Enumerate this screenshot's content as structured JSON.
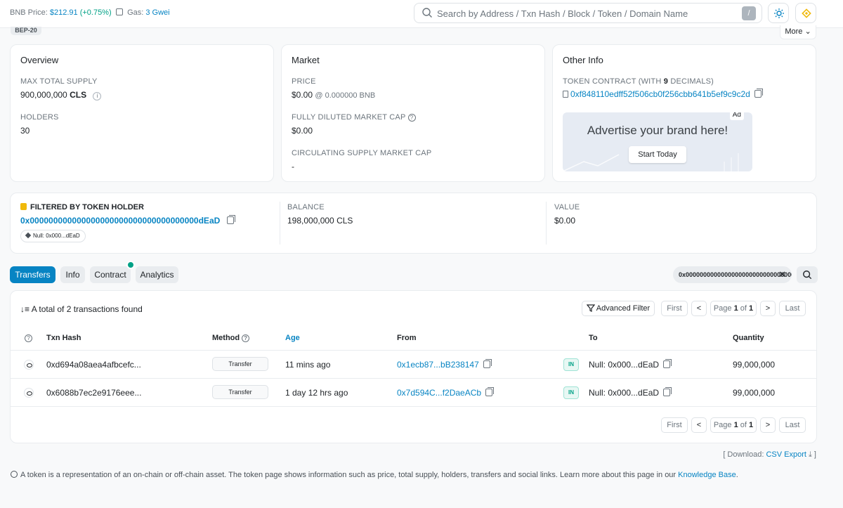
{
  "topbar": {
    "price_label": "BNB Price:",
    "price_value": "$212.91",
    "price_change": "(+0.75%)",
    "gas_label": "Gas:",
    "gas_value": "3 Gwei",
    "search_placeholder": "Search by Address / Txn Hash / Block / Token / Domain Name",
    "search_shortcut": "/"
  },
  "token_tag": "BEP-20",
  "more_label": "More",
  "overview": {
    "title": "Overview",
    "max_supply_label": "MAX TOTAL SUPPLY",
    "max_supply_value": "900,000,000",
    "max_supply_symbol": "CLS",
    "holders_label": "HOLDERS",
    "holders_value": "30"
  },
  "market": {
    "title": "Market",
    "price_label": "PRICE",
    "price_value": "$0.00",
    "price_bnb": "@ 0.000000 BNB",
    "fdmc_label": "FULLY DILUTED MARKET CAP",
    "fdmc_value": "$0.00",
    "csmc_label": "CIRCULATING SUPPLY MARKET CAP",
    "csmc_value": "-"
  },
  "other_info": {
    "title": "Other Info",
    "contract_label_pre": "TOKEN CONTRACT (WITH ",
    "contract_decimals": "9",
    "contract_label_post": " DECIMALS)",
    "contract_address": "0xf848110edff52f506cb0f256cbb641b5ef9c9c2d",
    "ad_label": "Ad",
    "ad_title": "Advertise your brand here!",
    "ad_button": "Start Today"
  },
  "holder": {
    "title": "FILTERED BY TOKEN HOLDER",
    "address": "0x000000000000000000000000000000000000dEaD",
    "tag": "Null: 0x000...dEaD",
    "balance_label": "BALANCE",
    "balance_value": "198,000,000 CLS",
    "value_label": "VALUE",
    "value_value": "$0.00"
  },
  "tabs": [
    "Transfers",
    "Info",
    "Contract",
    "Analytics"
  ],
  "filter_value": "0x0000000000000000000000000000000000...",
  "table": {
    "total_text": "A total of 2 transactions found",
    "advanced_filter": "Advanced Filter",
    "pager": {
      "first": "First",
      "prev": "<",
      "page_pre": "Page ",
      "page_cur": "1",
      "page_mid": " of ",
      "page_total": "1",
      "next": ">",
      "last": "Last"
    },
    "headers": {
      "txn": "Txn Hash",
      "method": "Method",
      "age": "Age",
      "from": "From",
      "to": "To",
      "qty": "Quantity"
    },
    "rows": [
      {
        "hash": "0xd694a08aea4afbcefc...",
        "method": "Transfer",
        "age": "11 mins ago",
        "from": "0x1ecb87...bB238147",
        "dir": "IN",
        "to": "Null: 0x000...dEaD",
        "qty": "99,000,000"
      },
      {
        "hash": "0x6088b7ec2e9176eee...",
        "method": "Transfer",
        "age": "1 day 12 hrs ago",
        "from": "0x7d594C...f2DaeACb",
        "dir": "IN",
        "to": "Null: 0x000...dEaD",
        "qty": "99,000,000"
      }
    ]
  },
  "download": {
    "pre": "[ Download: ",
    "link": "CSV Export",
    "post": " ]"
  },
  "footnote": {
    "text": "A token is a representation of an on-chain or off-chain asset. The token page shows information such as price, total supply, holders, transfers and social links. Learn more about this page in our ",
    "link": "Knowledge Base",
    "end": "."
  },
  "colors": {
    "link": "#0784c3",
    "accent_green": "#00a186",
    "bnb_yellow": "#f0b90b"
  }
}
